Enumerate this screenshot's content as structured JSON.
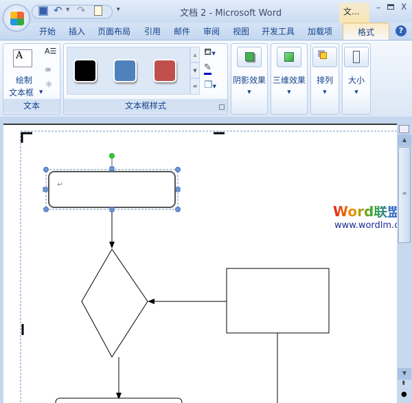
{
  "title": "文档 2 - Microsoft Word",
  "context_tab": "文...",
  "tabs": [
    "开始",
    "插入",
    "页面布局",
    "引用",
    "邮件",
    "审阅",
    "视图",
    "开发工具",
    "加载项",
    "格式"
  ],
  "text_group": {
    "draw_line1": "绘制",
    "draw_line2": "文本框",
    "label": "文本"
  },
  "style_group": {
    "label": "文本框样式",
    "swatches": [
      "#000000",
      "#4f81bd",
      "#c0504d"
    ]
  },
  "buttons": [
    "阴影效果",
    "三维效果",
    "排列",
    "大小"
  ],
  "watermark": {
    "brand": "Word联盟",
    "url": "www.wordlm.com"
  },
  "paragraph_mark": "↵"
}
